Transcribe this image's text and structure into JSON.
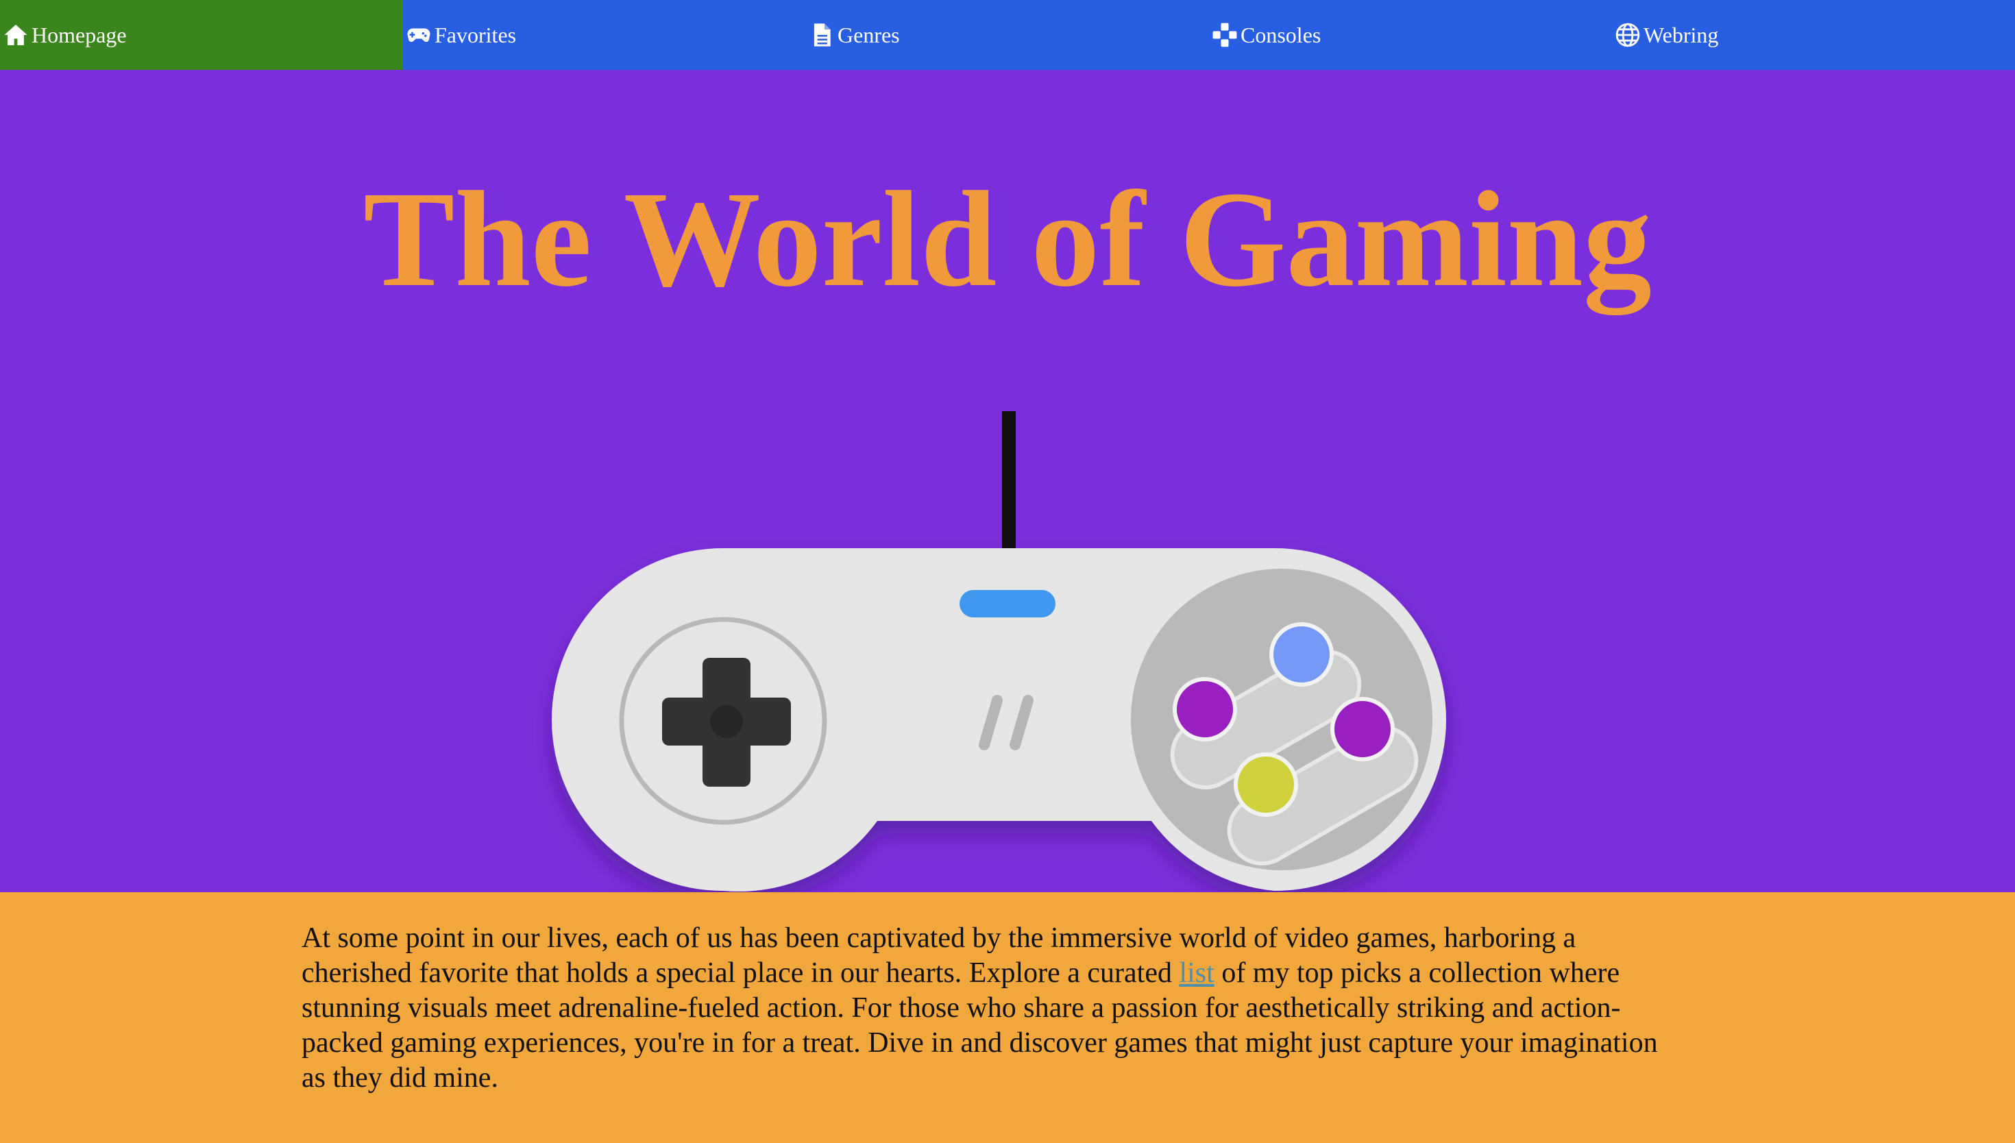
{
  "nav": {
    "items": [
      {
        "label": "Homepage",
        "icon": "home-icon",
        "active": true
      },
      {
        "label": "Favorites",
        "icon": "gamepad-icon",
        "active": false
      },
      {
        "label": "Genres",
        "icon": "document-icon",
        "active": false
      },
      {
        "label": "Consoles",
        "icon": "dpad-icon",
        "active": false
      },
      {
        "label": "Webring",
        "icon": "globe-icon",
        "active": false
      }
    ]
  },
  "hero": {
    "title": "The World of Gaming",
    "illustration": "snes-controller"
  },
  "intro": {
    "text_before_link": "At some point in our lives, each of us has been captivated by the immersive world of video games, harboring a cherished favorite that holds a special place in our hearts. Explore a curated ",
    "link_text": "list",
    "text_after_link": " of my top picks a collection where stunning visuals meet adrenaline-fueled action. For those who share a passion for aesthetically striking and action-packed gaming experiences, you're in for a treat. Dive in and discover games that might just capture your imagination as they did mine."
  },
  "colors": {
    "nav_background": "#285fe2",
    "nav_active": "#3a861c",
    "page_background": "#7b2fdc",
    "title": "#f09a3b",
    "intro_background": "#f1a73b",
    "link": "#4f8fa9"
  }
}
